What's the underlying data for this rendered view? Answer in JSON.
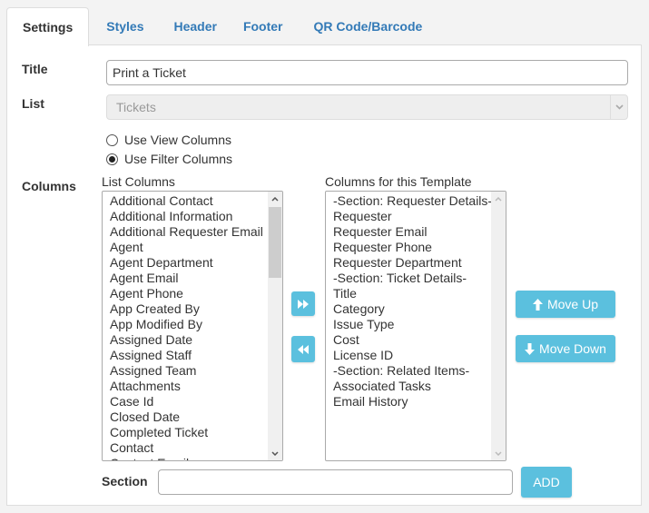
{
  "tabs": [
    {
      "label": "Settings",
      "active": true
    },
    {
      "label": "Styles",
      "active": false
    },
    {
      "label": "Header",
      "active": false
    },
    {
      "label": "Footer",
      "active": false
    },
    {
      "label": "QR Code/Barcode",
      "active": false
    }
  ],
  "form": {
    "title_label": "Title",
    "title_value": "Print a Ticket",
    "list_label": "List",
    "list_value": "Tickets",
    "radio_view": "Use View Columns",
    "radio_filter": "Use Filter Columns",
    "radio_selected": "Use Filter Columns",
    "columns_label": "Columns",
    "section_label": "Section",
    "section_value": ""
  },
  "list_columns": {
    "label": "List Columns",
    "items": [
      "Additional Contact",
      "Additional Information",
      "Additional Requester Email",
      "Agent",
      "Agent Department",
      "Agent Email",
      "Agent Phone",
      "App Created By",
      "App Modified By",
      "Assigned Date",
      "Assigned Staff",
      "Assigned Team",
      "Attachments",
      "Case Id",
      "Closed Date",
      "Completed Ticket",
      "Contact",
      "Contact Email"
    ]
  },
  "template_columns": {
    "label": "Columns for this Template",
    "items": [
      "-Section: Requester Details-",
      "Requester",
      "Requester Email",
      "Requester Phone",
      "Requester Department",
      "-Section: Ticket Details-",
      "Title",
      "Category",
      "Issue Type",
      "Cost",
      "License ID",
      "-Section: Related Items-",
      "Associated Tasks",
      "Email History"
    ]
  },
  "buttons": {
    "add_all": "fast-forward-icon",
    "remove_all": "fast-backward-icon",
    "move_up": "Move Up",
    "move_down": "Move Down",
    "add": "ADD"
  },
  "colors": {
    "accent": "#5bc0de",
    "link": "#337ab7"
  }
}
